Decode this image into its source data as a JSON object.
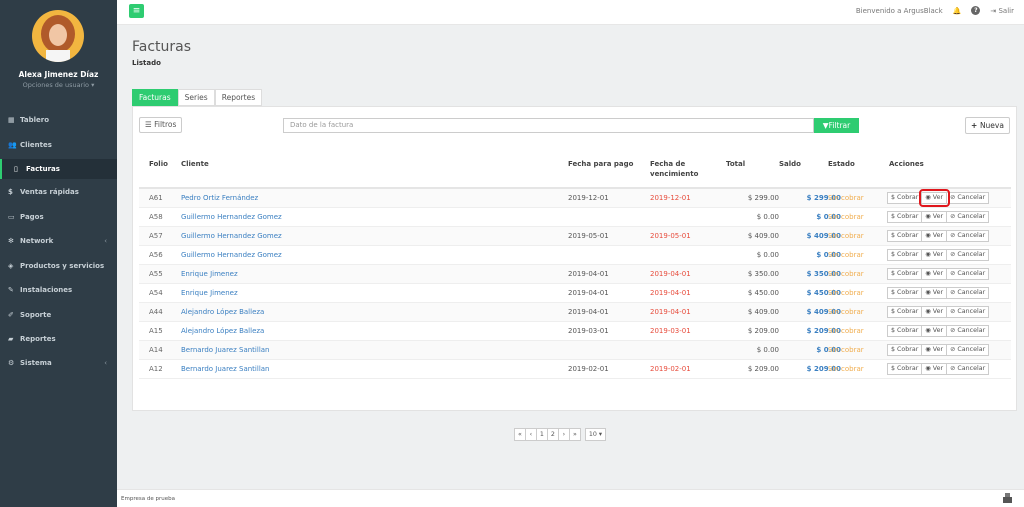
{
  "sidebar": {
    "user_name": "Alexa Jimenez Díaz",
    "user_options": "Opciones de usuario ▾",
    "items": [
      {
        "label": "Tablero",
        "icon": "dashboard-icon"
      },
      {
        "label": "Clientes",
        "icon": "users-icon"
      },
      {
        "label": "Facturas",
        "icon": "document-icon"
      },
      {
        "label": "Ventas rápidas",
        "icon": "dollar-icon"
      },
      {
        "label": "Pagos",
        "icon": "card-icon"
      },
      {
        "label": "Network",
        "icon": "network-icon"
      },
      {
        "label": "Productos y servicios",
        "icon": "tag-icon"
      },
      {
        "label": "Instalaciones",
        "icon": "wrench-icon"
      },
      {
        "label": "Soporte",
        "icon": "tool-icon"
      },
      {
        "label": "Reportes",
        "icon": "book-icon"
      },
      {
        "label": "Sistema",
        "icon": "gear-icon"
      }
    ]
  },
  "topbar": {
    "welcome": "Bienvenido a ArgusBlack",
    "logout": "Salir"
  },
  "page": {
    "title": "Facturas",
    "subtitle": "Listado"
  },
  "tabs": [
    "Facturas",
    "Series",
    "Reportes"
  ],
  "toolbar": {
    "filters_label": "Filtros",
    "search_placeholder": "Dato de la factura",
    "filter_label": "Filtrar",
    "new_label": "Nueva"
  },
  "table": {
    "headers": {
      "folio": "Folio",
      "cliente": "Cliente",
      "fecha_pago": "Fecha para pago",
      "fecha_venc_1": "Fecha de",
      "fecha_venc_2": "vencimiento",
      "total": "Total",
      "saldo": "Saldo",
      "estado": "Estado",
      "acciones": "Acciones"
    },
    "action_labels": {
      "cobrar": "$ Cobrar",
      "ver": "Ver",
      "cancelar": "Cancelar"
    },
    "rows": [
      {
        "folio": "A61",
        "cliente": "Pedro Ortiz Fernández",
        "pago": "2019-12-01",
        "venc": "2019-12-01",
        "total": "$ 299.00",
        "saldo": "$ 299.00",
        "estado": "Sin cobrar"
      },
      {
        "folio": "A58",
        "cliente": "Guillermo Hernandez Gomez",
        "pago": "",
        "venc": "",
        "total": "$ 0.00",
        "saldo": "$ 0.00",
        "estado": "Sin cobrar"
      },
      {
        "folio": "A57",
        "cliente": "Guillermo Hernandez Gomez",
        "pago": "2019-05-01",
        "venc": "2019-05-01",
        "total": "$ 409.00",
        "saldo": "$ 409.00",
        "estado": "Sin cobrar"
      },
      {
        "folio": "A56",
        "cliente": "Guillermo Hernandez Gomez",
        "pago": "",
        "venc": "",
        "total": "$ 0.00",
        "saldo": "$ 0.00",
        "estado": "Sin cobrar"
      },
      {
        "folio": "A55",
        "cliente": "Enrique Jimenez",
        "pago": "2019-04-01",
        "venc": "2019-04-01",
        "total": "$ 350.00",
        "saldo": "$ 350.00",
        "estado": "Sin cobrar"
      },
      {
        "folio": "A54",
        "cliente": "Enrique Jimenez",
        "pago": "2019-04-01",
        "venc": "2019-04-01",
        "total": "$ 450.00",
        "saldo": "$ 450.00",
        "estado": "Sin cobrar"
      },
      {
        "folio": "A44",
        "cliente": "Alejandro López Balleza",
        "pago": "2019-04-01",
        "venc": "2019-04-01",
        "total": "$ 409.00",
        "saldo": "$ 409.00",
        "estado": "Sin cobrar"
      },
      {
        "folio": "A15",
        "cliente": "Alejandro López Balleza",
        "pago": "2019-03-01",
        "venc": "2019-03-01",
        "total": "$ 209.00",
        "saldo": "$ 209.00",
        "estado": "Sin cobrar"
      },
      {
        "folio": "A14",
        "cliente": "Bernardo Juarez Santillan",
        "pago": "",
        "venc": "",
        "total": "$ 0.00",
        "saldo": "$ 0.00",
        "estado": "Sin cobrar"
      },
      {
        "folio": "A12",
        "cliente": "Bernardo Juarez Santillan",
        "pago": "2019-02-01",
        "venc": "2019-02-01",
        "total": "$ 209.00",
        "saldo": "$ 209.00",
        "estado": "Sin cobrar"
      }
    ]
  },
  "pagination": {
    "first": "«",
    "prev": "‹",
    "pages": [
      "1",
      "2"
    ],
    "next": "›",
    "last": "»",
    "page_size": "10 ▾"
  },
  "footer": {
    "company": "Empresa de prueba"
  },
  "colors": {
    "accent": "#2ecc71",
    "sidebar": "#2f3d47",
    "link": "#3a7fc1",
    "due_date": "#e74c3c",
    "status_unpaid": "#f0ad4e",
    "highlight": "#e0161c"
  }
}
